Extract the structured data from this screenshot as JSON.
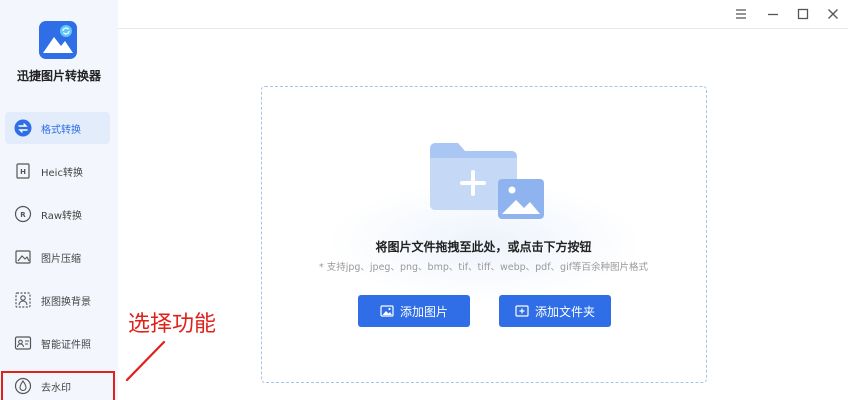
{
  "app": {
    "name": "迅捷图片转换器"
  },
  "sidebar": {
    "items": [
      {
        "label": "格式转换",
        "icon": "format-convert-icon",
        "active": true
      },
      {
        "label": "Heic转换",
        "icon": "heic-icon",
        "active": false
      },
      {
        "label": "Raw转换",
        "icon": "raw-icon",
        "active": false
      },
      {
        "label": "图片压缩",
        "icon": "image-compress-icon",
        "active": false
      },
      {
        "label": "抠图换背景",
        "icon": "cutout-icon",
        "active": false
      },
      {
        "label": "智能证件照",
        "icon": "id-photo-icon",
        "active": false
      },
      {
        "label": "去水印",
        "icon": "watermark-remove-icon",
        "active": false
      }
    ]
  },
  "annotation": {
    "text": "选择功能",
    "color": "#e0201b"
  },
  "window_controls": [
    "menu-icon",
    "minimize-icon",
    "maximize-icon",
    "close-icon"
  ],
  "drop_zone": {
    "main_tip": "将图片文件拖拽至此处，或点击下方按钮",
    "sub_tip": "* 支持jpg、jpeg、png、bmp、tif、tiff、webp、pdf、gif等百余种图片格式"
  },
  "buttons": {
    "add_image": "添加图片",
    "add_folder": "添加文件夹"
  },
  "colors": {
    "accent": "#2f6ee6",
    "sidebar_bg": "#f3f7fd",
    "highlight": "#e0201b"
  }
}
